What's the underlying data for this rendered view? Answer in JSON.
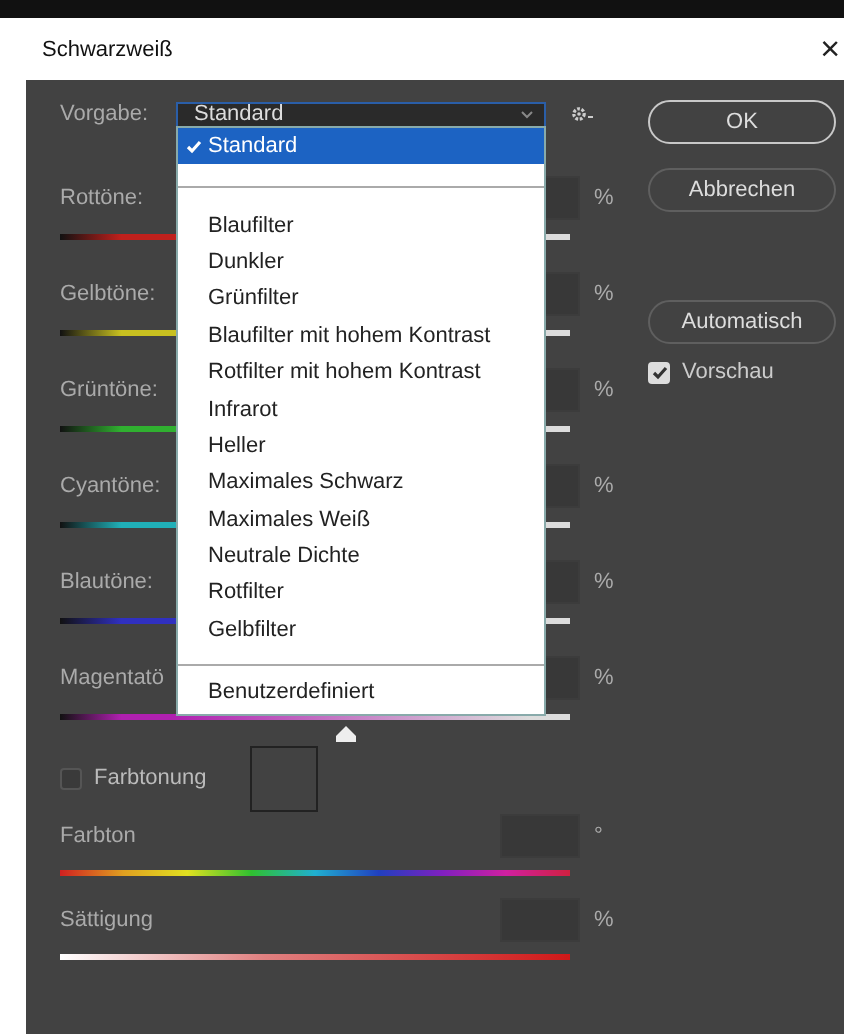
{
  "window": {
    "title": "Schwarzweiß",
    "close": "×"
  },
  "preset": {
    "label": "Vorgabe:",
    "value": "Standard",
    "expanded": true
  },
  "preset_menu": {
    "groups": [
      [
        {
          "label": "Standard",
          "selected": true
        }
      ],
      [
        {
          "label": "Blaufilter",
          "selected": false
        },
        {
          "label": "Dunkler",
          "selected": false
        },
        {
          "label": "Grünfilter",
          "selected": false
        },
        {
          "label": "Blaufilter mit hohem Kontrast",
          "selected": false
        },
        {
          "label": "Rotfilter mit hohem Kontrast",
          "selected": false
        },
        {
          "label": "Infrarot",
          "selected": false
        },
        {
          "label": "Heller",
          "selected": false
        },
        {
          "label": "Maximales Schwarz",
          "selected": false
        },
        {
          "label": "Maximales Weiß",
          "selected": false
        },
        {
          "label": "Neutrale Dichte",
          "selected": false
        },
        {
          "label": "Rotfilter",
          "selected": false
        },
        {
          "label": "Gelbfilter",
          "selected": false
        }
      ],
      [
        {
          "label": "Benutzerdefiniert",
          "selected": false
        }
      ]
    ]
  },
  "channels": [
    {
      "label": "Rottöne:",
      "unit": "%",
      "color": "#c0201c"
    },
    {
      "label": "Gelbtöne:",
      "unit": "%",
      "color": "#c8c020"
    },
    {
      "label": "Grüntöne:",
      "unit": "%",
      "color": "#30b030"
    },
    {
      "label": "Cyantöne:",
      "unit": "%",
      "color": "#20b0b8"
    },
    {
      "label": "Blautöne:",
      "unit": "%",
      "color": "#3030c0"
    },
    {
      "label": "Magentatö",
      "unit": "%",
      "color": "#b020b0",
      "level": 0.56
    }
  ],
  "tint": {
    "label": "Farbtonung",
    "checked": false
  },
  "hue": {
    "label": "Farbton",
    "unit": "°"
  },
  "saturation": {
    "label": "Sättigung",
    "unit": "%"
  },
  "buttons": [
    {
      "label": "OK",
      "default": true
    },
    {
      "label": "Abbrechen",
      "default": false
    },
    {
      "label": "Automatisch",
      "default": false
    }
  ],
  "preview": {
    "label": "Vorschau",
    "checked": true
  }
}
